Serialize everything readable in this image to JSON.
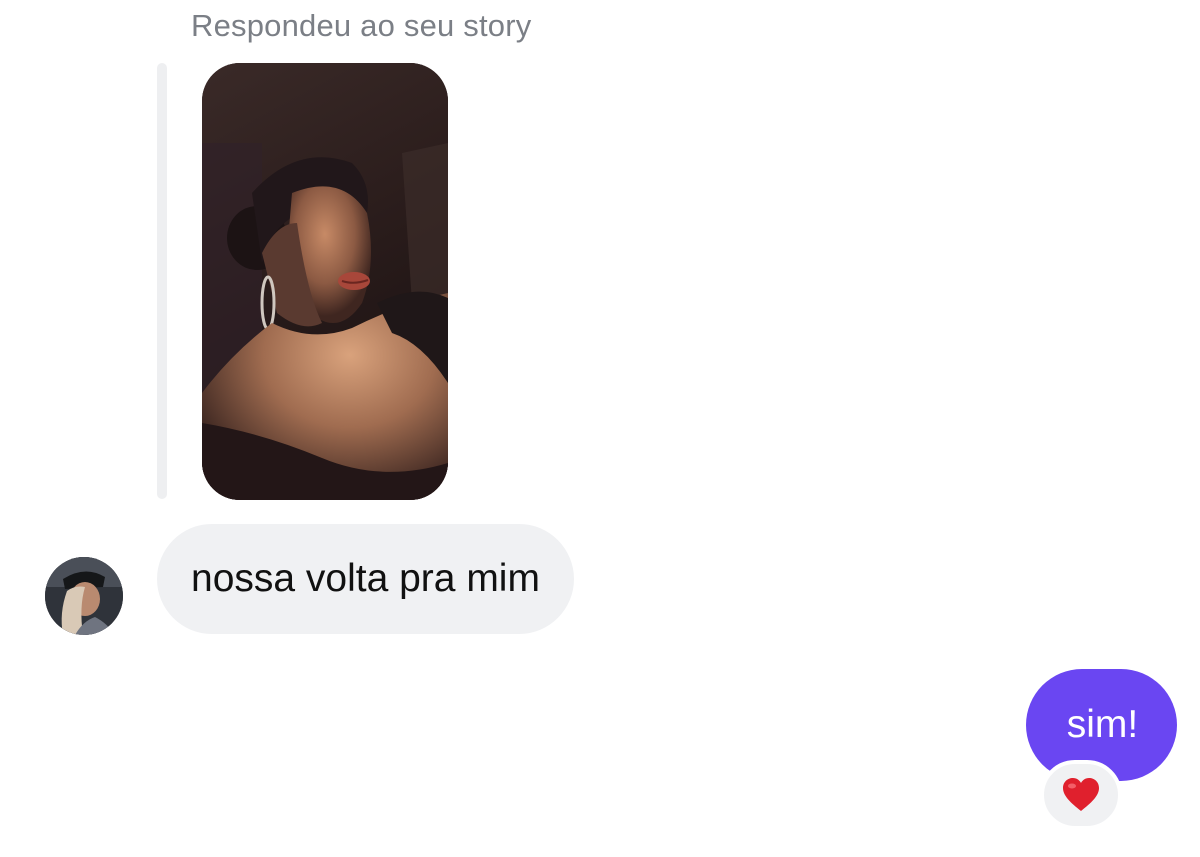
{
  "story_reply": {
    "label": "Respondeu ao seu story",
    "thumbnail": "story-photo"
  },
  "incoming_message": {
    "text": "nossa volta pra mim",
    "sender_avatar": "avatar"
  },
  "outgoing_message": {
    "text": "sim!",
    "reaction": "heart-icon"
  },
  "colors": {
    "outgoing_bubble": "#6a46f2",
    "incoming_bubble": "#f0f1f3",
    "label_text": "#7b7f86",
    "reaction_heart": "#e0202d"
  }
}
